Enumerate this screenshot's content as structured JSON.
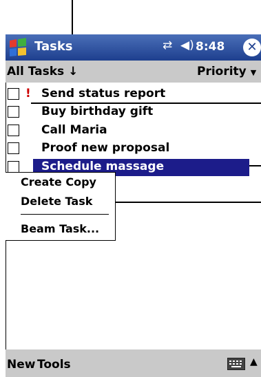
{
  "titlebar": {
    "app_title": "Tasks",
    "time": "8:48",
    "close_label": "✕",
    "speaker_glyph": "◀€",
    "connection_glyph": "⇄"
  },
  "filterbar": {
    "category_label": "All Tasks",
    "sort_label": "Priority"
  },
  "tasks": [
    {
      "label": "Send status report",
      "priority_mark": "!"
    },
    {
      "label": "Buy birthday gift",
      "priority_mark": ""
    },
    {
      "label": "Call Maria",
      "priority_mark": ""
    },
    {
      "label": "Proof new proposal",
      "priority_mark": ""
    },
    {
      "label": "Schedule massage",
      "priority_mark": ""
    }
  ],
  "context_menu": {
    "items": [
      "Create Copy",
      "Delete Task",
      "Beam Task..."
    ]
  },
  "bottombar": {
    "new_label": "New",
    "tools_label": "Tools"
  },
  "icons": {
    "start": "windows-logo-icon",
    "keyboard": "keyboard-icon",
    "chevron_up": "chevron-up-icon"
  }
}
